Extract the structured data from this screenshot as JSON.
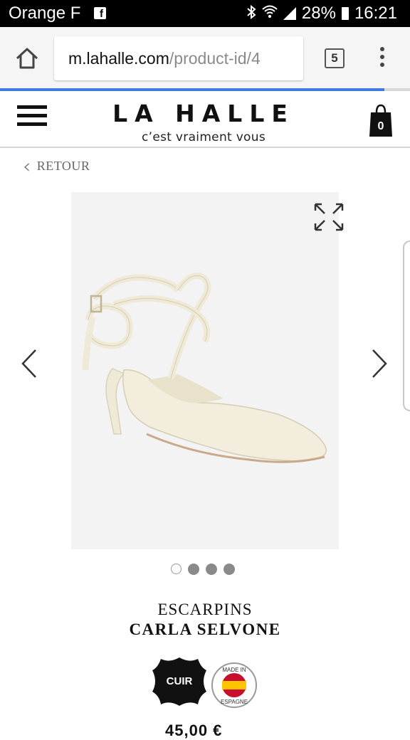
{
  "status_bar": {
    "carrier": "Orange F",
    "battery": "28%",
    "time": "16:21"
  },
  "browser": {
    "url_domain": "m.lahalle.com",
    "url_path": "/product-id/4",
    "tab_count": "5"
  },
  "header": {
    "logo": "LA HALLE",
    "tagline": "c’est vraiment vous",
    "cart_count": "0"
  },
  "nav": {
    "back_label": "RETOUR"
  },
  "gallery": {
    "image_count": 4,
    "active_index": 0
  },
  "product": {
    "category": "ESCARPINS",
    "name": "CARLA SELVONE",
    "leather_badge": "CUIR",
    "origin_badge": "MADE IN ESPAGNE",
    "price_partial": "45,00 €"
  },
  "colors": {
    "accent_progress": "#3f7ae0",
    "text": "#111111"
  }
}
